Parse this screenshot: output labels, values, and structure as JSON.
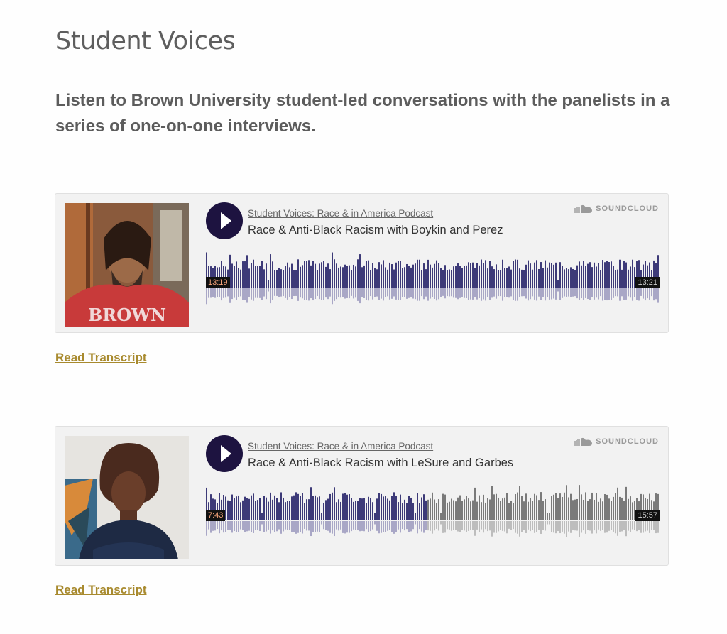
{
  "page": {
    "title": "Student Voices",
    "intro": "Listen to Brown University student-led conversations with the panelists in a series of one-on-one interviews."
  },
  "players": [
    {
      "podcast": "Student Voices: Race & in America Podcast",
      "track": "Race & Anti-Black Racism with Boykin and Perez",
      "brand": "SOUNDCLOUD",
      "current_time": "13:19",
      "total_time": "13:21",
      "progress": 0.998,
      "transcript_link": "Read Transcript"
    },
    {
      "podcast": "Student Voices: Race & in America Podcast",
      "track": "Race & Anti-Black Racism with LeSure and Garbes",
      "brand": "SOUNDCLOUD",
      "current_time": "7:43",
      "total_time": "15:57",
      "progress": 0.484,
      "transcript_link": "Read Transcript"
    }
  ],
  "colors": {
    "played": "#3d3a78",
    "played_reflection": "#a9a7c6",
    "unplayed": "#7a7a7a",
    "unplayed_reflection": "#bdbdbd",
    "link": "#a88a2e",
    "play_button": "#1d1340"
  }
}
